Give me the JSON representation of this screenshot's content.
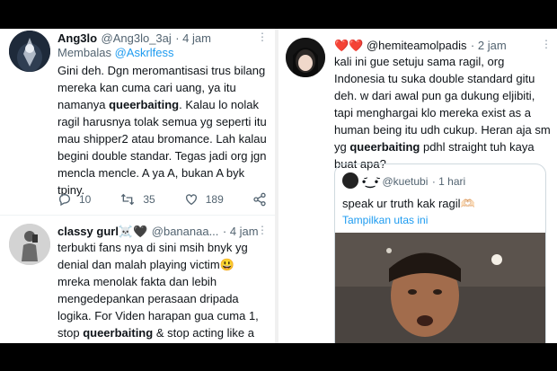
{
  "tweet1": {
    "name": "Ang3lo",
    "handle": "@Ang3lo_3aj",
    "time": "· 4 jam",
    "reply_prefix": "Membalas ",
    "reply_to": "@Askrlfess",
    "text_a": "Gini deh. Dgn meromantisasi trus bilang mereka kan cuma cari uang,  ya itu namanya ",
    "text_hl": "queerbaiting",
    "text_b": ". Kalau lo nolak ragil harusnya tolak semua yg seperti itu mau shipper2 atau bromance. Lah kalau begini double standar. Tegas jadi org jgn mencla mencle. A ya A, bukan A byk tpiny.",
    "replies": "10",
    "retweets": "35",
    "likes": "189"
  },
  "tweet2": {
    "name": "classy gurl☠️🖤",
    "handle": "@bananaa...",
    "time": "· 4 jam",
    "text_a": "terbukti fans nya di sini msih bnyk yg denial dan malah playing victim😃 mreka menolak fakta dan lebih mengedepankan perasaan dripada logika. For Viden harapan gua cuma 1, stop ",
    "text_hl": "queerbaiting",
    "text_b": " & stop acting like a gay to gain fame & money, kalian bisa"
  },
  "tweet3": {
    "name": "❤️❤️ @hemiteamolpadis",
    "time": "· 2 jam",
    "text_a": "kali ini gue setuju sama ragil, org Indonesia tu suka double standard gitu deh. w dari awal pun ga dukung eljibiti, tapi menghargai klo mereka exist as a human being itu udh cukup. Heran aja sm yg ",
    "text_hl": "queerbaiting",
    "text_b": " pdhl straight tuh kaya buat apa?"
  },
  "quote": {
    "name": "•᷄‿•᷅",
    "handle": "@kuetubi",
    "time": "· 1 hari",
    "text": "speak ur truth kak ragil🫶🏻",
    "thread_link": "Tampilkan utas ini"
  },
  "colors": {
    "link": "#1d9bf0",
    "text": "#0f1419",
    "muted": "#536471"
  }
}
